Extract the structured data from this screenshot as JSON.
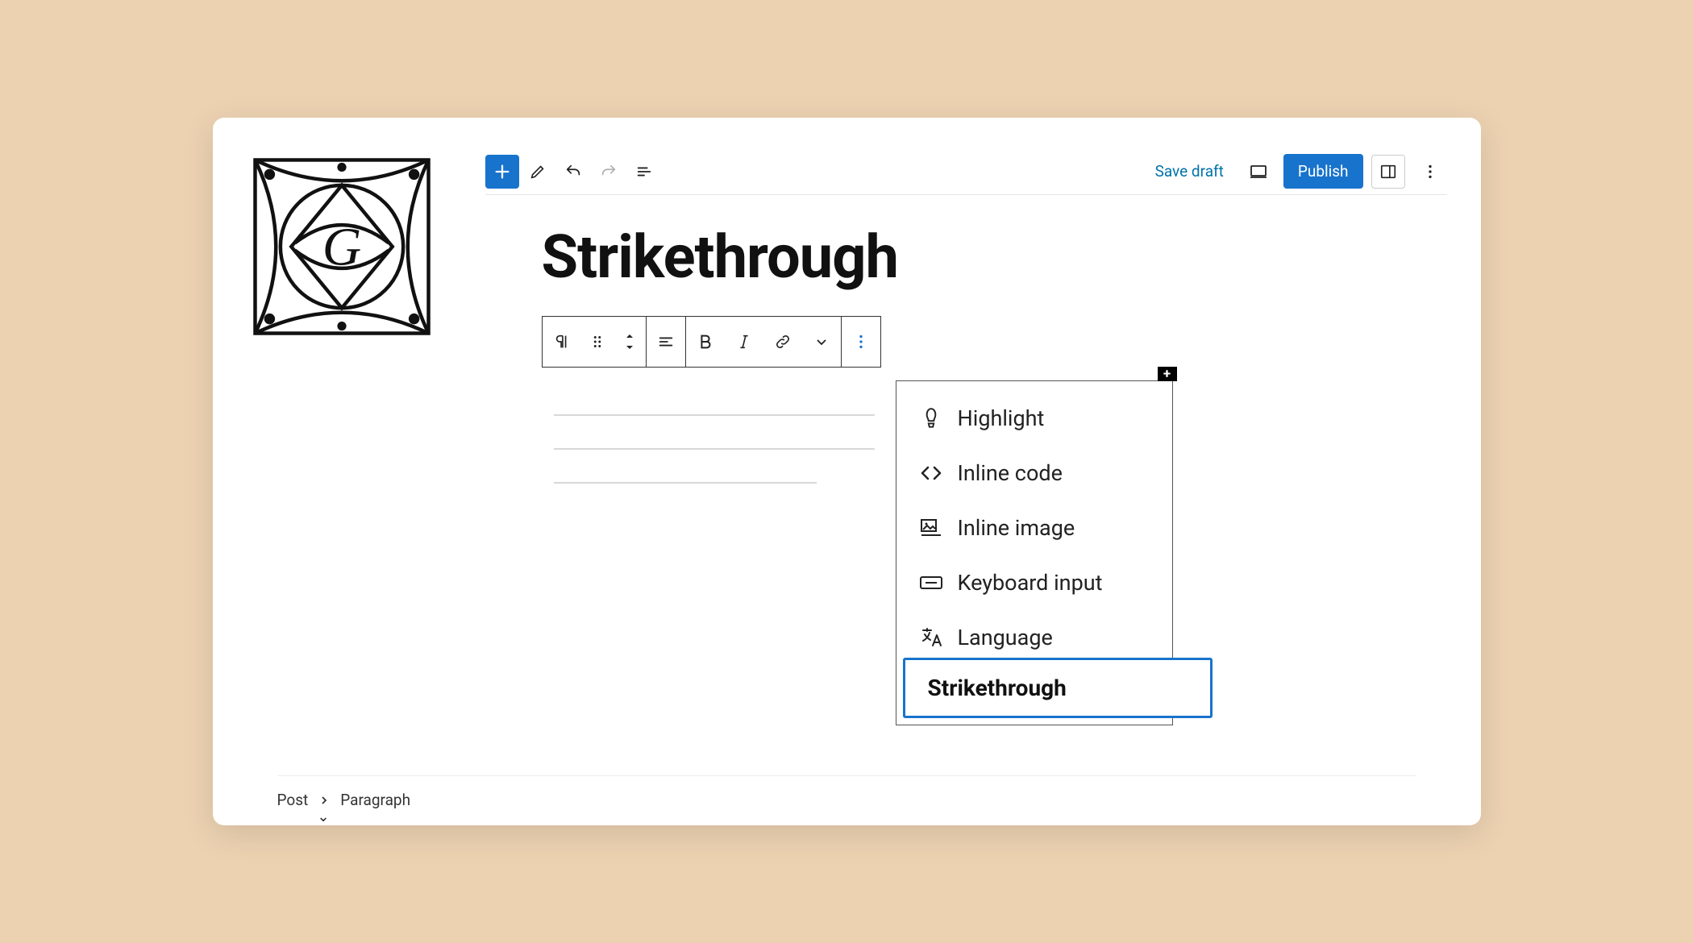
{
  "topbar": {
    "save_draft": "Save draft",
    "publish": "Publish"
  },
  "post": {
    "title": "Strikethrough"
  },
  "dropdown": {
    "items": [
      {
        "label": "Highlight",
        "icon": "highlight"
      },
      {
        "label": "Inline code",
        "icon": "code"
      },
      {
        "label": "Inline image",
        "icon": "image"
      },
      {
        "label": "Keyboard input",
        "icon": "keyboard"
      },
      {
        "label": "Language",
        "icon": "language"
      }
    ],
    "highlighted": "Strikethrough"
  },
  "breadcrumb": {
    "root": "Post",
    "current": "Paragraph"
  }
}
